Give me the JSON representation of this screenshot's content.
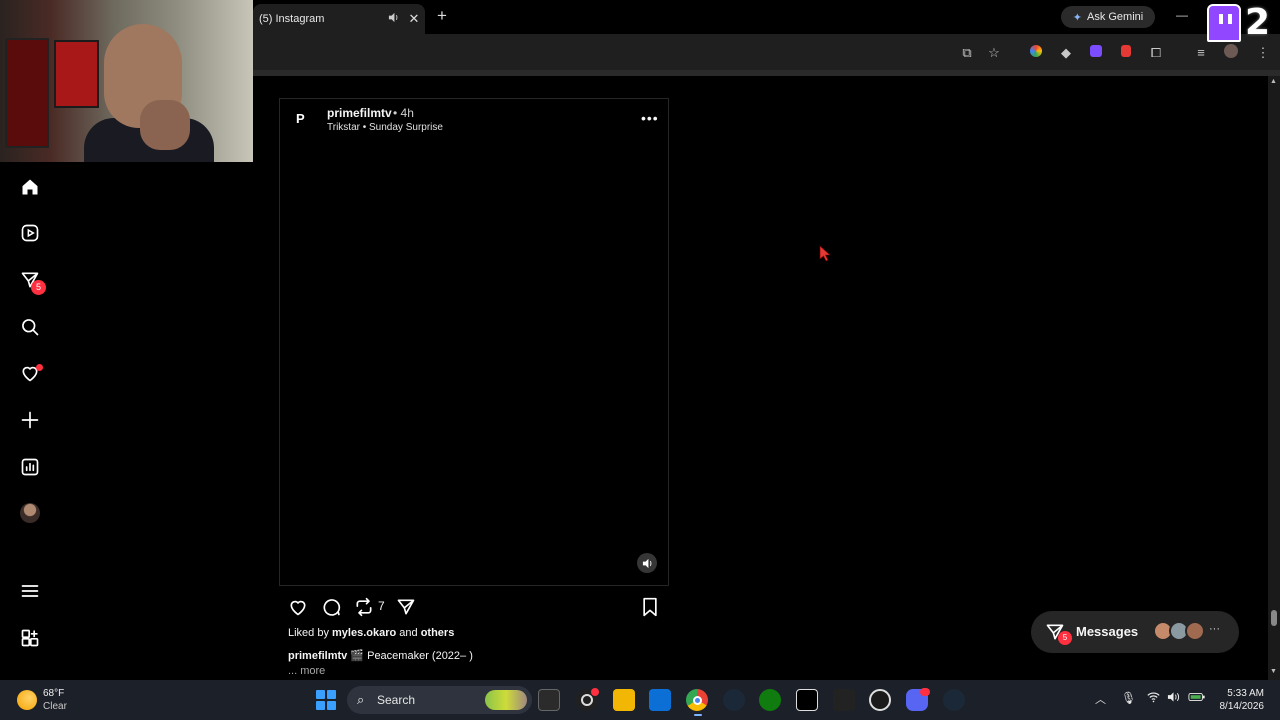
{
  "browser": {
    "tab_title": "(5) Instagram",
    "tab_speaker_icon": "speaker-icon",
    "tab_close": "✕",
    "new_tab": "+",
    "gemini_label": "Ask Gemini",
    "minimize": "—"
  },
  "overlay": {
    "twitch_count": "2"
  },
  "sidebar": {
    "items": [
      {
        "name": "home",
        "icon": "home-icon"
      },
      {
        "name": "reels",
        "icon": "reels-icon"
      },
      {
        "name": "messages",
        "icon": "messenger-icon",
        "badge": "5"
      },
      {
        "name": "search",
        "icon": "search-icon"
      },
      {
        "name": "notifications",
        "icon": "heart-icon"
      },
      {
        "name": "create",
        "icon": "plus-icon"
      },
      {
        "name": "dashboard",
        "icon": "chart-icon"
      },
      {
        "name": "profile",
        "icon": "avatar"
      },
      {
        "name": "more",
        "icon": "hamburger-icon"
      },
      {
        "name": "also-from-meta",
        "icon": "grid-icon"
      }
    ]
  },
  "post": {
    "avatar_letter": "P",
    "username": "primefilmtv",
    "time": "• 4h",
    "audio": "Trikstar • Sunday Surprise",
    "more": "•••",
    "repost_count": "7",
    "liked_by_prefix": "Liked by ",
    "liked_by_user": "myles.okaro",
    "liked_by_middle": " and ",
    "liked_by_others": "others",
    "caption_user": "primefilmtv",
    "caption_text": " 🎬 Peacemaker (2022– )",
    "more_link": "... more"
  },
  "messages": {
    "label": "Messages",
    "badge": "5",
    "ellipsis": "···"
  },
  "taskbar": {
    "temperature": "68°F",
    "condition": "Clear",
    "search_placeholder": "Search",
    "time": "5:33 AM",
    "date": "8/14/2026"
  },
  "colors": {
    "accent_badge": "#ff3040",
    "page_bg": "#000000",
    "twitch": "#9146ff"
  }
}
